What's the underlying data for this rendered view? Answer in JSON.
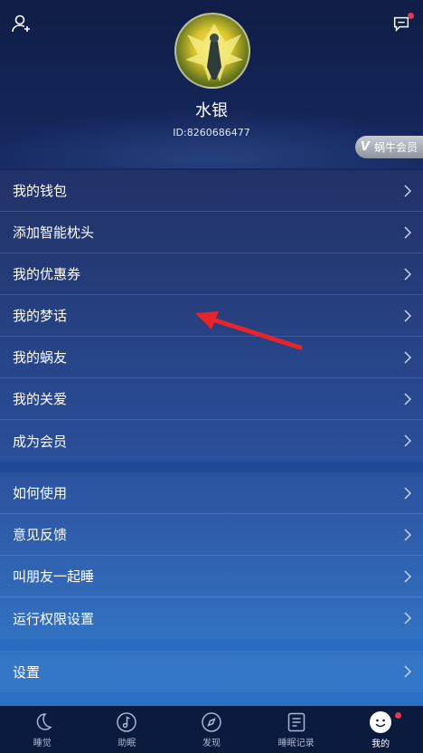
{
  "header": {
    "add_user_icon": "user-add-icon",
    "message_icon": "chat-bubble-icon",
    "username": "水银",
    "user_id": "ID:8260686477",
    "vip_badge_mark": "V",
    "vip_badge_label": "蜗牛会员"
  },
  "menu_group_1": [
    {
      "label": "我的钱包"
    },
    {
      "label": "添加智能枕头"
    },
    {
      "label": "我的优惠券"
    },
    {
      "label": "我的梦话"
    },
    {
      "label": "我的蜗友"
    },
    {
      "label": "我的关爱"
    },
    {
      "label": "成为会员"
    }
  ],
  "menu_group_2": [
    {
      "label": "如何使用"
    },
    {
      "label": "意见反馈"
    },
    {
      "label": "叫朋友一起睡"
    },
    {
      "label": "运行权限设置"
    }
  ],
  "menu_group_3": [
    {
      "label": "设置"
    }
  ],
  "tabbar": {
    "tabs": [
      {
        "label": "睡觉",
        "icon": "moon-icon"
      },
      {
        "label": "助眠",
        "icon": "music-note-icon"
      },
      {
        "label": "发现",
        "icon": "compass-icon"
      },
      {
        "label": "睡眠记录",
        "icon": "sleep-record-icon"
      },
      {
        "label": "我的",
        "icon": "smiley-icon"
      }
    ],
    "active": "我的"
  },
  "colors": {
    "background_top": "#0f1d47",
    "background_bottom": "#2a72c6",
    "tabbar": "#0b1b3d",
    "notification_dot": "#e8384a",
    "annotation_arrow": "#e8242a"
  }
}
